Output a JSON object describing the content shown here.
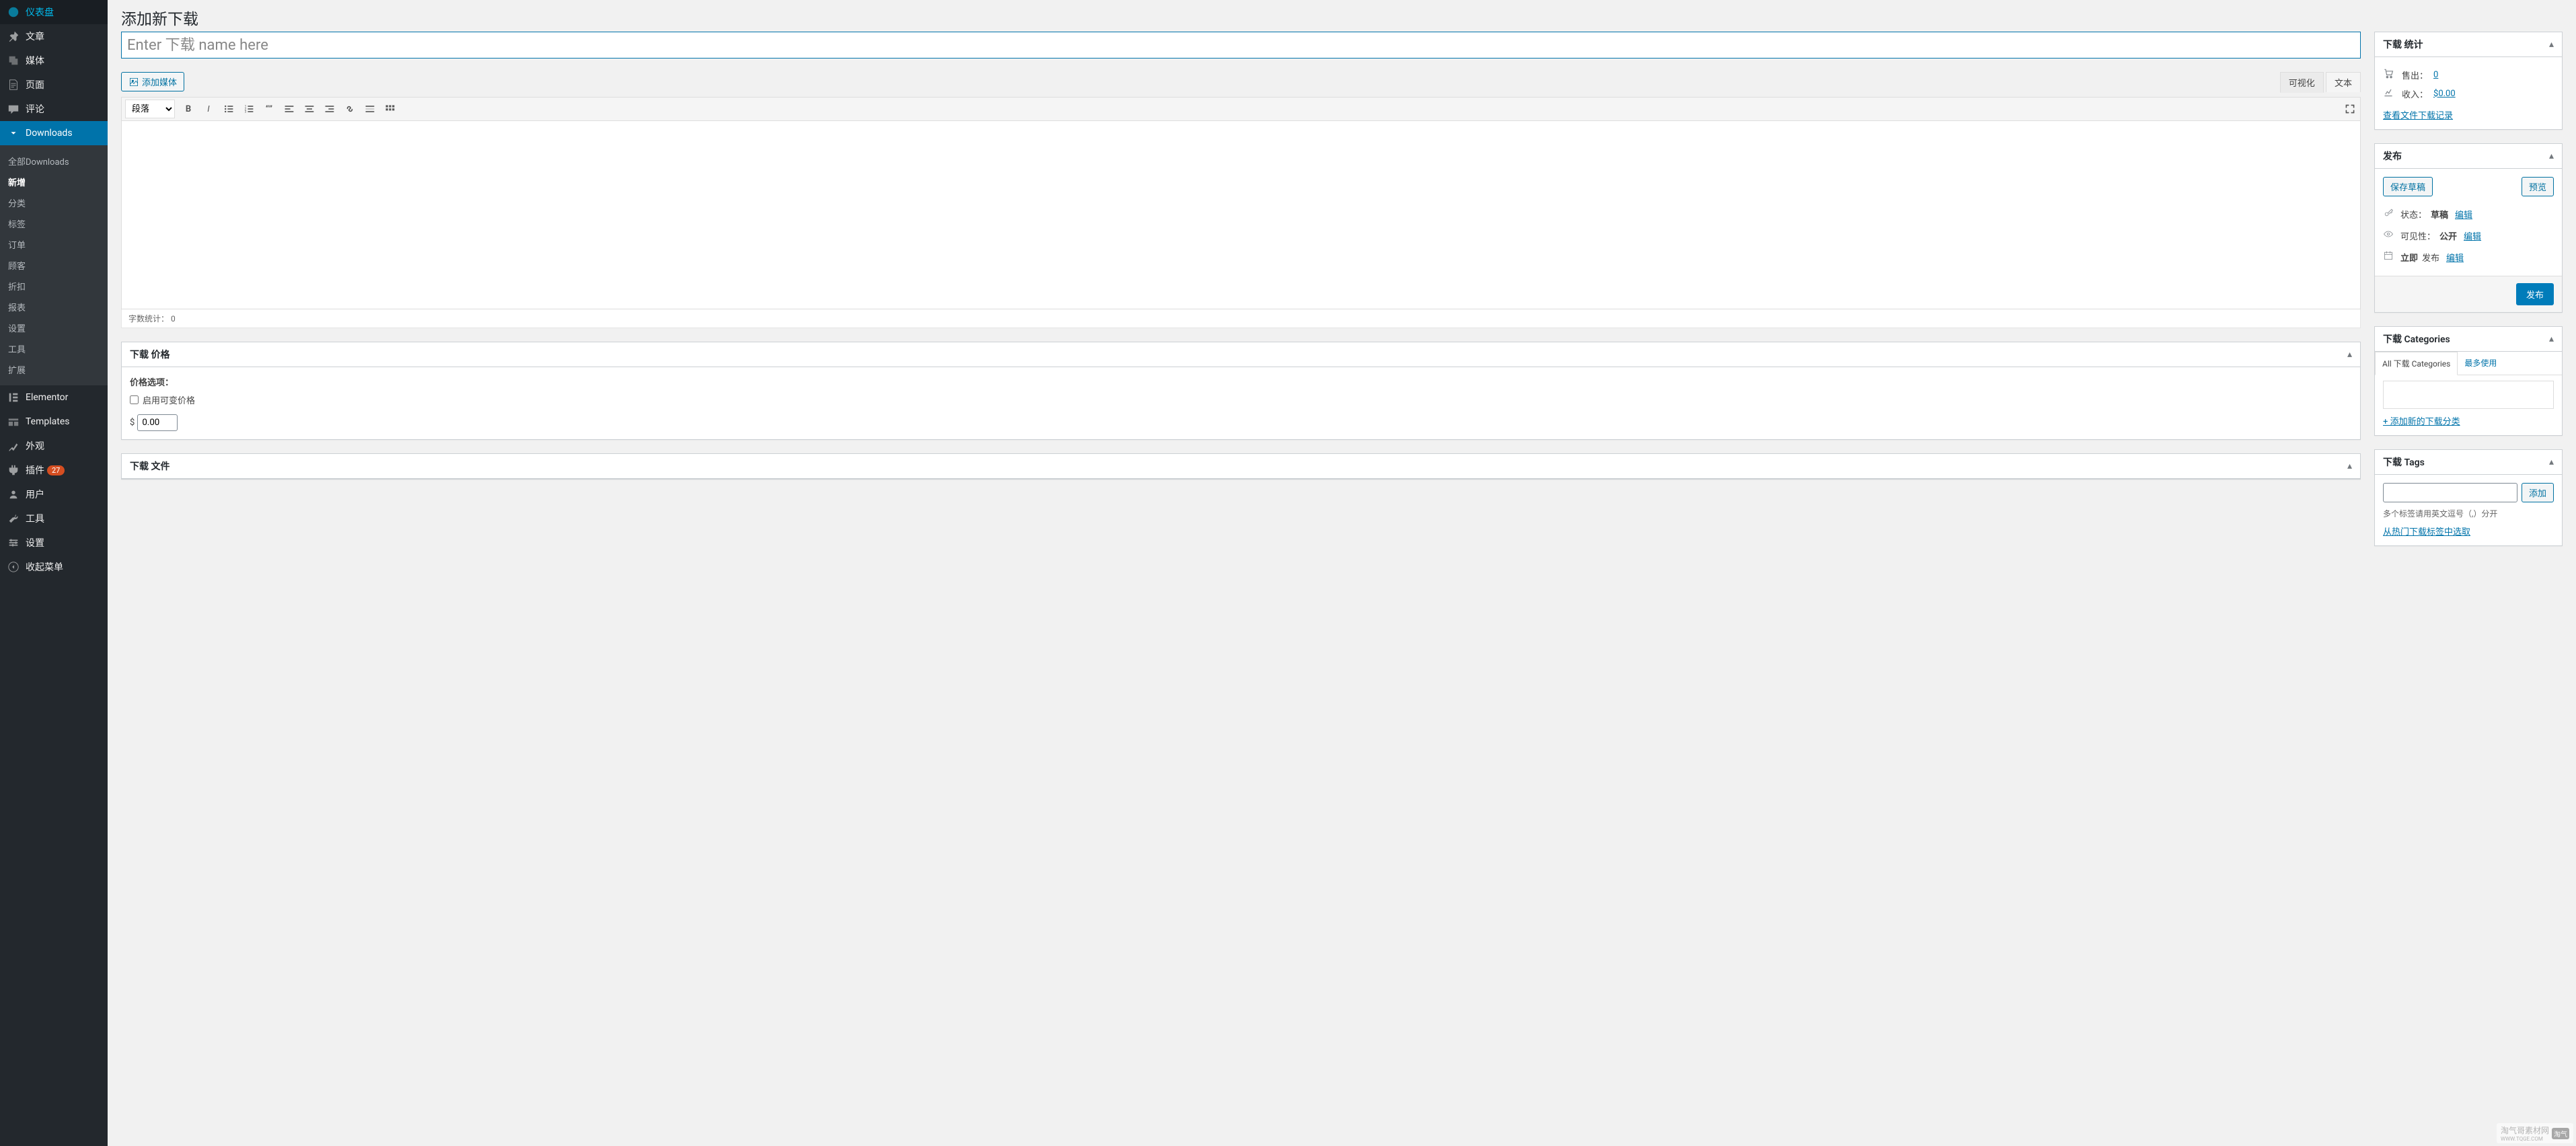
{
  "sidebar": {
    "items": [
      {
        "icon": "dashboard",
        "label": "仪表盘"
      },
      {
        "icon": "pin",
        "label": "文章"
      },
      {
        "icon": "media",
        "label": "媒体"
      },
      {
        "icon": "page",
        "label": "页面"
      },
      {
        "icon": "comment",
        "label": "评论"
      },
      {
        "icon": "download",
        "label": "Downloads",
        "active": true
      },
      {
        "icon": "elementor",
        "label": "Elementor"
      },
      {
        "icon": "templates",
        "label": "Templates"
      },
      {
        "icon": "appearance",
        "label": "外观"
      },
      {
        "icon": "plugin",
        "label": "插件",
        "badge": "27"
      },
      {
        "icon": "users",
        "label": "用户"
      },
      {
        "icon": "tools",
        "label": "工具"
      },
      {
        "icon": "settings",
        "label": "设置"
      },
      {
        "icon": "collapse",
        "label": "收起菜单"
      }
    ],
    "submenu": [
      {
        "label": "全部Downloads"
      },
      {
        "label": "新增",
        "current": true
      },
      {
        "label": "分类"
      },
      {
        "label": "标签"
      },
      {
        "label": "订单"
      },
      {
        "label": "顾客"
      },
      {
        "label": "折扣"
      },
      {
        "label": "报表"
      },
      {
        "label": "设置"
      },
      {
        "label": "工具"
      },
      {
        "label": "扩展"
      }
    ]
  },
  "page": {
    "title": "添加新下载",
    "name_placeholder": "Enter 下载 name here"
  },
  "editor": {
    "add_media": "添加媒体",
    "tab_visual": "可视化",
    "tab_text": "文本",
    "format_select": "段落",
    "word_count_label": "字数统计：",
    "word_count": "0"
  },
  "boxes": {
    "prices": {
      "title": "下载 价格",
      "options_label": "价格选项：",
      "variable_label": "启用可变价格",
      "currency": "$",
      "price_value": "0.00"
    },
    "files": {
      "title": "下载 文件"
    },
    "stats": {
      "title": "下载 统计",
      "sales_label": "售出：",
      "sales_value": "0",
      "earnings_label": "收入：",
      "earnings_value": "$0.00",
      "log_link": "查看文件下载记录"
    },
    "publish": {
      "title": "发布",
      "save_draft": "保存草稿",
      "preview": "预览",
      "status_label": "状态：",
      "status_value": "草稿",
      "visibility_label": "可见性：",
      "visibility_value": "公开",
      "publish_prefix": "立即",
      "publish_suffix": "发布",
      "edit": "编辑",
      "submit": "发布"
    },
    "categories": {
      "title": "下载 Categories",
      "tab_all": "All 下载 Categories",
      "tab_most": "最多使用",
      "add_new": "+ 添加新的下载分类"
    },
    "tags": {
      "title": "下载 Tags",
      "add_btn": "添加",
      "hint": "多个标签请用英文逗号（,）分开",
      "choose_link": "从热门下载标签中选取"
    }
  },
  "watermark": {
    "text": "淘气哥素材网",
    "sub": "WWW.TQGE.COM",
    "badge": "淘气"
  }
}
